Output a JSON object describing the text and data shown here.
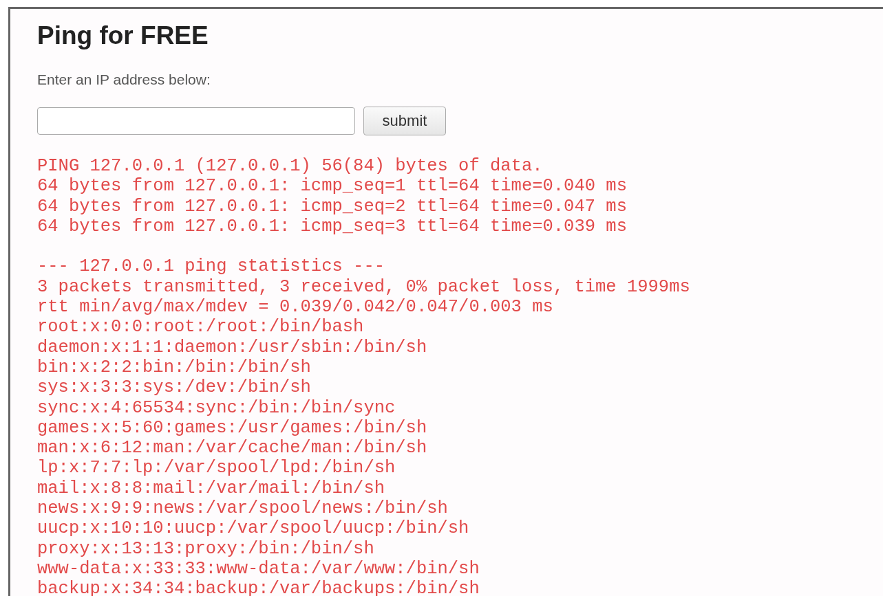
{
  "heading": "Ping for FREE",
  "prompt": "Enter an IP address below:",
  "submit_button": "submit",
  "output_blocks": [
    {
      "lines": [
        "PING 127.0.0.1 (127.0.0.1) 56(84) bytes of data.",
        "64 bytes from 127.0.0.1: icmp_seq=1 ttl=64 time=0.040 ms",
        "64 bytes from 127.0.0.1: icmp_seq=2 ttl=64 time=0.047 ms",
        "64 bytes from 127.0.0.1: icmp_seq=3 ttl=64 time=0.039 ms"
      ]
    },
    {
      "lines": [
        "--- 127.0.0.1 ping statistics ---",
        "3 packets transmitted, 3 received, 0% packet loss, time 1999ms",
        "rtt min/avg/max/mdev = 0.039/0.042/0.047/0.003 ms",
        "root:x:0:0:root:/root:/bin/bash",
        "daemon:x:1:1:daemon:/usr/sbin:/bin/sh",
        "bin:x:2:2:bin:/bin:/bin/sh",
        "sys:x:3:3:sys:/dev:/bin/sh",
        "sync:x:4:65534:sync:/bin:/bin/sync",
        "games:x:5:60:games:/usr/games:/bin/sh",
        "man:x:6:12:man:/var/cache/man:/bin/sh",
        "lp:x:7:7:lp:/var/spool/lpd:/bin/sh",
        "mail:x:8:8:mail:/var/mail:/bin/sh",
        "news:x:9:9:news:/var/spool/news:/bin/sh",
        "uucp:x:10:10:uucp:/var/spool/uucp:/bin/sh",
        "proxy:x:13:13:proxy:/bin:/bin/sh",
        "www-data:x:33:33:www-data:/var/www:/bin/sh",
        "backup:x:34:34:backup:/var/backups:/bin/sh"
      ]
    }
  ]
}
